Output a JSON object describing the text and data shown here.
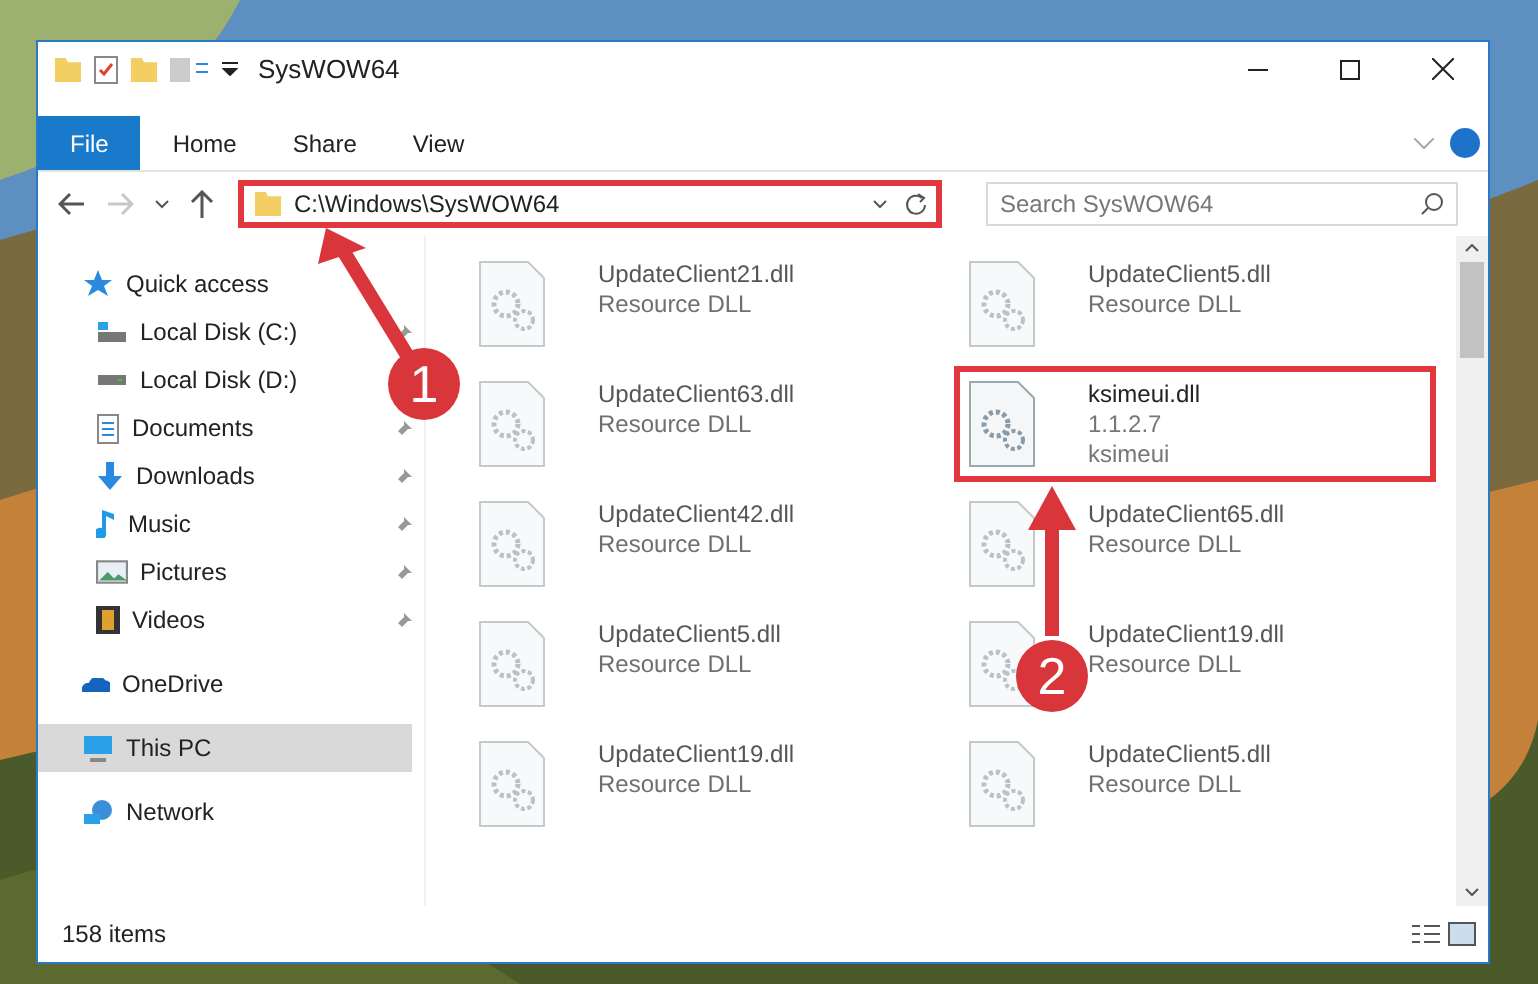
{
  "window": {
    "title": "SysWOW64"
  },
  "ribbon_tabs": [
    {
      "label": "File",
      "kind": "menu"
    },
    {
      "label": "Home",
      "kind": "tab"
    },
    {
      "label": "Share",
      "kind": "tab"
    },
    {
      "label": "View",
      "kind": "tab"
    }
  ],
  "navigation": {
    "forward_disabled": true
  },
  "address_bar": {
    "path": "C:\\Windows\\SysWOW64",
    "highlighted": true
  },
  "search": {
    "placeholder": "Search SysWOW64"
  },
  "sidebar": {
    "items": [
      {
        "label": "Quick access",
        "selected": false,
        "children": [
          {
            "label": "Local Disk (C:)",
            "pinned": true,
            "selected": false
          },
          {
            "label": "Local Disk (D:)",
            "selected": false
          },
          {
            "label": "Documents",
            "pinned": true,
            "selected": false
          },
          {
            "label": "Downloads",
            "pinned": true,
            "selected": false
          },
          {
            "label": "Music",
            "pinned": true,
            "selected": false
          },
          {
            "label": "Pictures",
            "pinned": true,
            "selected": false
          },
          {
            "label": "Videos",
            "pinned": true,
            "selected": false
          }
        ]
      },
      {
        "label": "OneDrive",
        "selected": false
      },
      {
        "label": "This PC",
        "selected": true
      },
      {
        "label": "Network",
        "selected": false
      }
    ]
  },
  "files": [
    {
      "name": "UpdateClient21.dll",
      "lines": [
        "Resource DLL"
      ],
      "blurred": true,
      "highlighted": false
    },
    {
      "name": "UpdateClient5.dll",
      "lines": [
        "Resource DLL"
      ],
      "blurred": true,
      "highlighted": false
    },
    {
      "name": "UpdateClient63.dll",
      "lines": [
        "Resource DLL"
      ],
      "blurred": true,
      "highlighted": false
    },
    {
      "name": "ksimeui.dll",
      "lines": [
        "1.1.2.7",
        "ksimeui"
      ],
      "blurred": false,
      "highlighted": true
    },
    {
      "name": "UpdateClient42.dll",
      "lines": [
        "Resource DLL"
      ],
      "blurred": true,
      "highlighted": false
    },
    {
      "name": "UpdateClient65.dll",
      "lines": [
        "Resource DLL"
      ],
      "blurred": true,
      "highlighted": false
    },
    {
      "name": "UpdateClient5.dll",
      "lines": [
        "Resource DLL"
      ],
      "blurred": true,
      "highlighted": false
    },
    {
      "name": "UpdateClient19.dll",
      "lines": [
        "Resource DLL"
      ],
      "blurred": true,
      "highlighted": false
    },
    {
      "name": "UpdateClient19.dll",
      "lines": [
        "Resource DLL"
      ],
      "blurred": true,
      "highlighted": false
    },
    {
      "name": "UpdateClient5.dll",
      "lines": [
        "Resource DLL"
      ],
      "blurred": true,
      "highlighted": false
    }
  ],
  "status_bar": {
    "item_count": "158 items"
  },
  "annotations": [
    {
      "label": "1"
    },
    {
      "label": "2"
    }
  ]
}
